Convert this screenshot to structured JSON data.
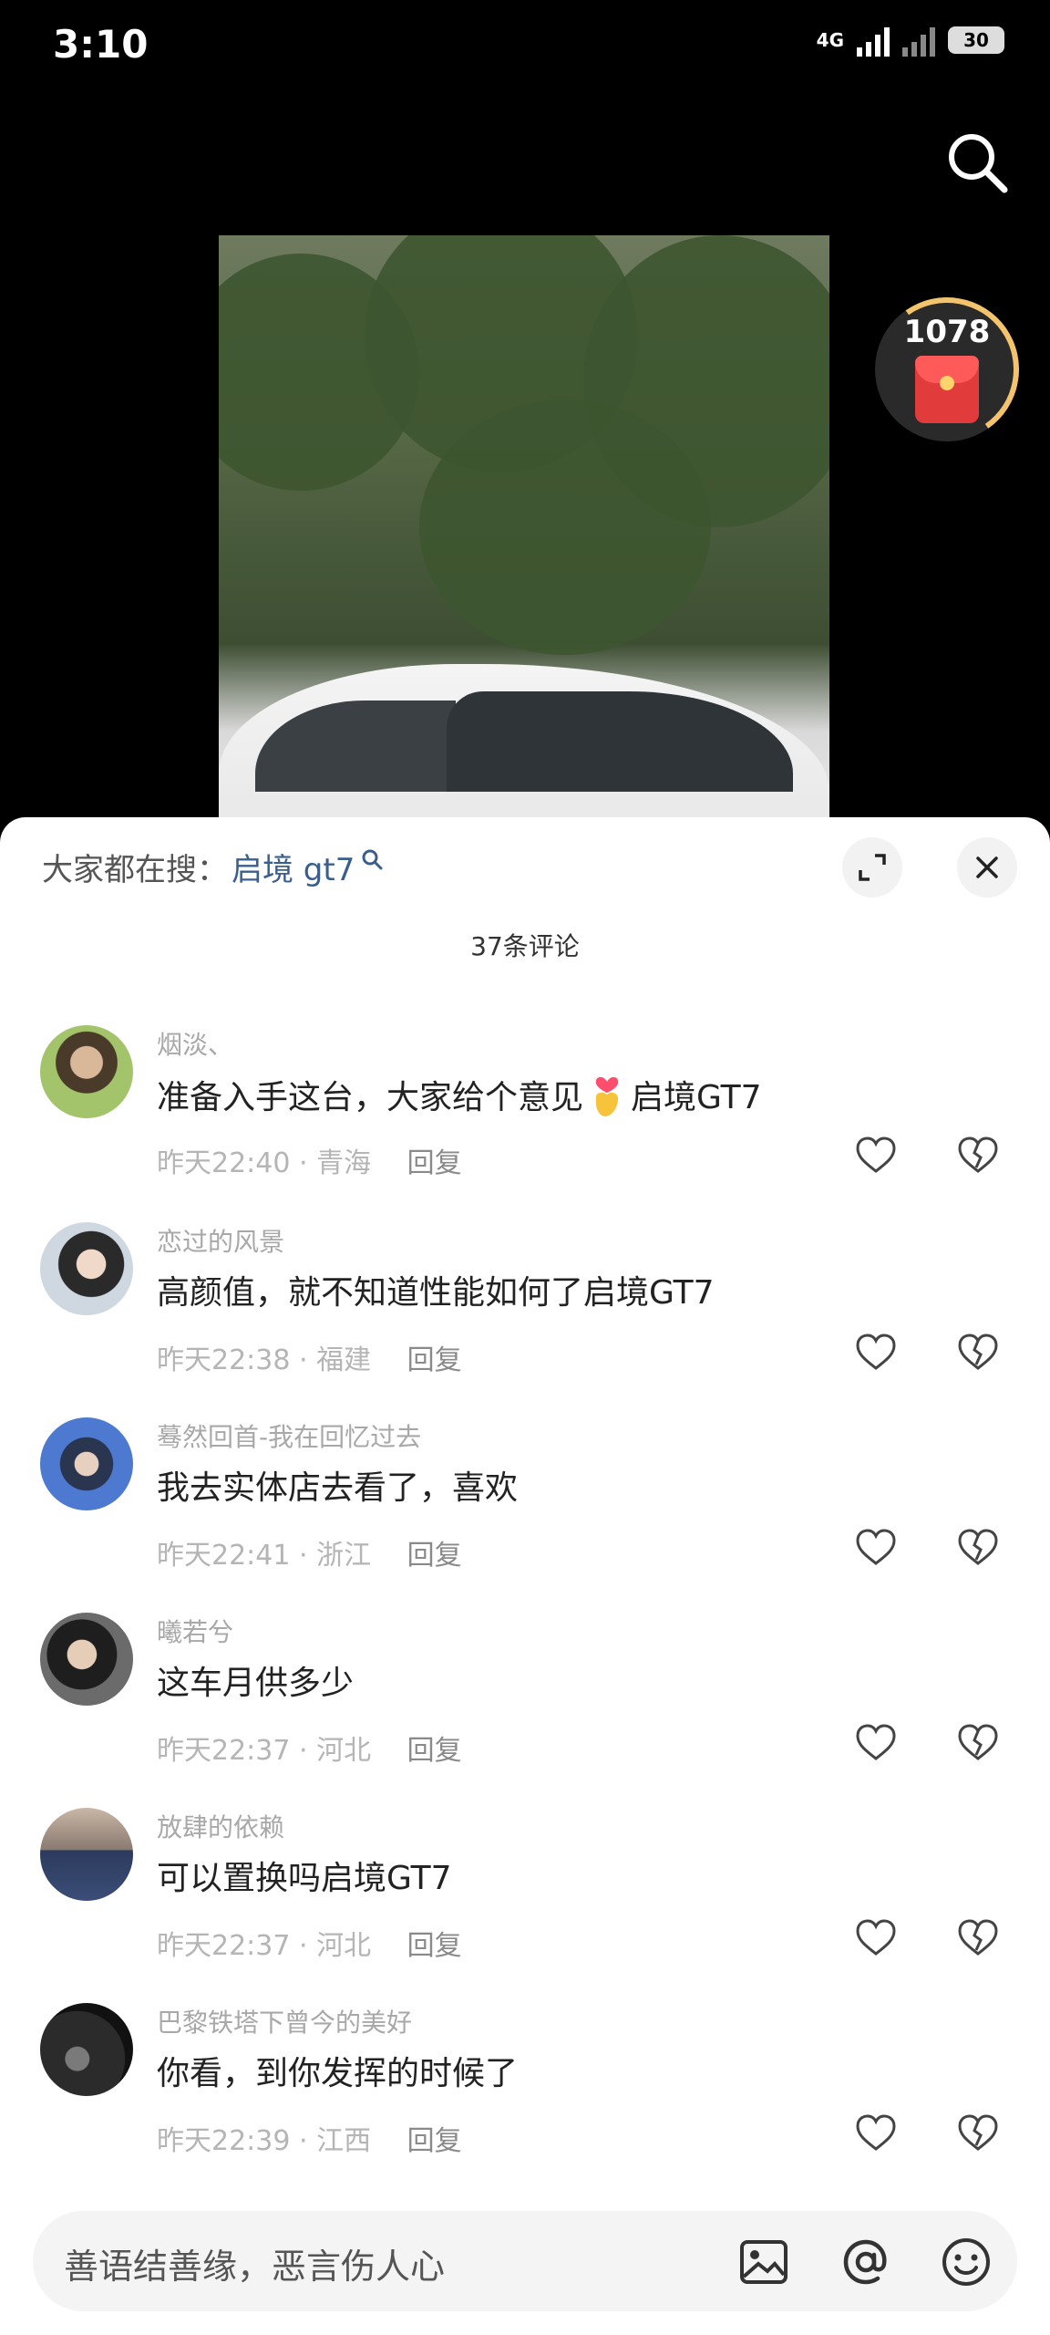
{
  "status": {
    "time": "3:10",
    "network": "4G",
    "battery": "30"
  },
  "video": {
    "red_packet_count": "1078"
  },
  "sheet": {
    "hot_search_label": "大家都在搜：",
    "hot_search_term": "启境 gt7",
    "comment_count": "37条评论"
  },
  "comments": [
    {
      "user": "烟淡、",
      "pre": "准备入手这台，大家给个意见",
      "post": "启境GT7",
      "time": "昨天22:40",
      "region": "青海",
      "reply": "回复"
    },
    {
      "user": "恋过的风景",
      "pre": "高颜值，就不知道性能如何了启境GT7",
      "post": "",
      "time": "昨天22:38",
      "region": "福建",
      "reply": "回复"
    },
    {
      "user": "蓦然回首-我在回忆过去",
      "pre": "我去实体店去看了，喜欢",
      "post": "",
      "time": "昨天22:41",
      "region": "浙江",
      "reply": "回复"
    },
    {
      "user": "曦若兮",
      "pre": "这车月供多少",
      "post": "",
      "time": "昨天22:37",
      "region": "河北",
      "reply": "回复"
    },
    {
      "user": "放肆的依赖",
      "pre": "可以置换吗启境GT7",
      "post": "",
      "time": "昨天22:37",
      "region": "河北",
      "reply": "回复"
    },
    {
      "user": "巴黎铁塔下曾今的美好",
      "pre": "你看，到你发挥的时候了",
      "post": "",
      "time": "昨天22:39",
      "region": "江西",
      "reply": "回复"
    }
  ],
  "input": {
    "placeholder": "善语结善缘，恶言伤人心"
  },
  "colors": {
    "accent_link": "#3a5f8e",
    "red_packet": "#e23b3b",
    "meta_gray": "#b5b5b5"
  }
}
